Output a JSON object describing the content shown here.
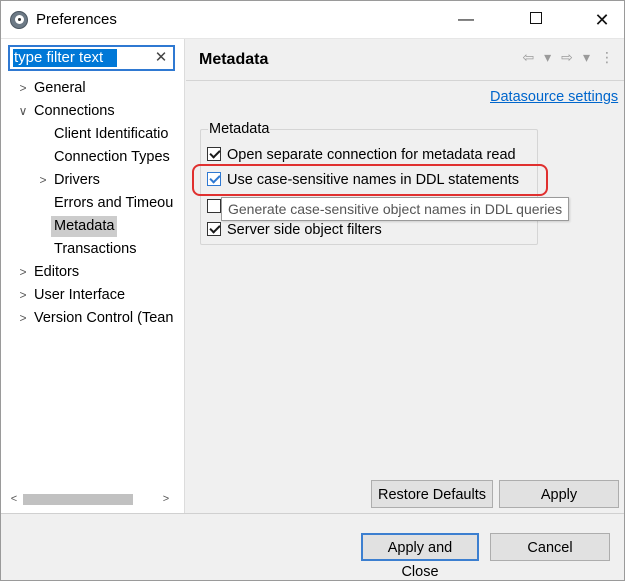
{
  "window": {
    "title": "Preferences",
    "minimize_glyph": "—",
    "close_glyph": "✕"
  },
  "filter": {
    "value": "type filter text",
    "clear_glyph": "✕"
  },
  "tree": {
    "items": [
      {
        "label": "General",
        "arrow": ">"
      },
      {
        "label": "Connections",
        "arrow": "∨"
      },
      {
        "label": "Client Identificatio",
        "arrow": ""
      },
      {
        "label": "Connection Types",
        "arrow": ""
      },
      {
        "label": "Drivers",
        "arrow": ">"
      },
      {
        "label": "Errors and Timeou",
        "arrow": ""
      },
      {
        "label": "Metadata",
        "arrow": "",
        "selected": true
      },
      {
        "label": "Transactions",
        "arrow": ""
      },
      {
        "label": "Editors",
        "arrow": ">"
      },
      {
        "label": "User Interface",
        "arrow": ">"
      },
      {
        "label": "Version Control (Tean",
        "arrow": ">"
      }
    ]
  },
  "page": {
    "title": "Metadata",
    "nav": {
      "back": "⇦",
      "back_menu": "▾",
      "forward": "⇨",
      "forward_menu": "▾",
      "more": "⋮"
    },
    "datasource_link": "Datasource settings",
    "group": {
      "label": "Metadata",
      "options": [
        {
          "label": "Open separate connection for metadata read",
          "checked": true
        },
        {
          "label": "Use case-sensitive names in DDL statements",
          "checked": true
        },
        {
          "label": "",
          "checked": false
        },
        {
          "label": "Server side object filters",
          "checked": true
        }
      ]
    },
    "tooltip": "Generate case-sensitive object names in DDL queries",
    "restore_defaults": "Restore Defaults",
    "apply": "Apply"
  },
  "footer": {
    "apply_and_close": "Apply and Close",
    "cancel": "Cancel"
  },
  "scrollbar": {
    "left": "<",
    "right": ">"
  }
}
